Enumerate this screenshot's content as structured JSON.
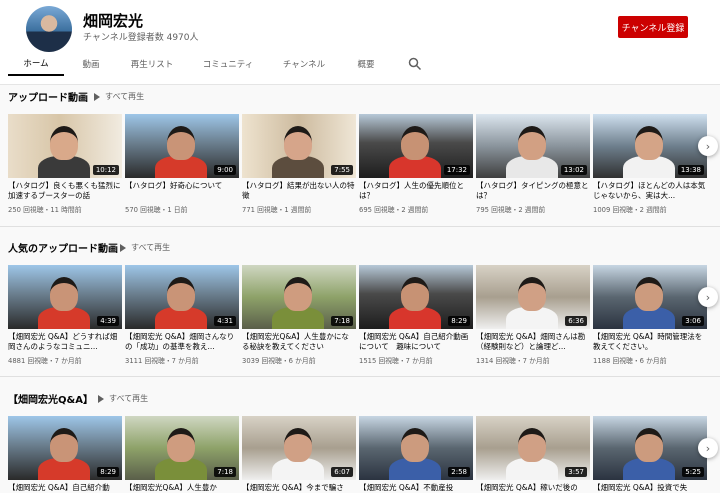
{
  "channel": {
    "name": "畑岡宏光",
    "subscribers": "チャンネル登録者数 4970人",
    "subscribe_label": "チャンネル登録"
  },
  "tabs": [
    "ホーム",
    "動画",
    "再生リスト",
    "コミュニティ",
    "チャンネル",
    "概要"
  ],
  "active_tab": "ホーム",
  "sections": [
    {
      "title": "アップロード動画",
      "play_all": "すべて再生",
      "videos": [
        {
          "title": "【ハタログ】良くも悪くも猛烈に加速するブースターの話",
          "meta": "250 回視聴・11 時間前",
          "duration": "10:12"
        },
        {
          "title": "【ハタログ】好奇心について",
          "meta": "570 回視聴・1 日前",
          "duration": "9:00"
        },
        {
          "title": "【ハタログ】結果が出ない人の特徴",
          "meta": "771 回視聴・1 週間前",
          "duration": "7:55"
        },
        {
          "title": "【ハタログ】人生の優先順位とは？",
          "meta": "695 回視聴・2 週間前",
          "duration": "17:32"
        },
        {
          "title": "【ハタログ】タイピングの極意とは？",
          "meta": "795 回視聴・2 週間前",
          "duration": "13:02"
        },
        {
          "title": "【ハタログ】ほとんどの人は本気じゃないから、実は大...",
          "meta": "1009 回視聴・2 週間前",
          "duration": "13:38"
        }
      ]
    },
    {
      "title": "人気のアップロード動画",
      "play_all": "すべて再生",
      "videos": [
        {
          "title": "【畑岡宏光 Q&A】どうすれば畑岡さんのようなコミュニ...",
          "meta": "4881 回視聴・7 か月前",
          "duration": "4:39"
        },
        {
          "title": "【畑岡宏光 Q&A】畑岡さんなりの「成功」の基準を教え...",
          "meta": "3111 回視聴・7 か月前",
          "duration": "4:31"
        },
        {
          "title": "【畑岡宏光Q&A】人生豊かになる秘訣を教えてください",
          "meta": "3039 回視聴・6 か月前",
          "duration": "7:18"
        },
        {
          "title": "【畑岡宏光 Q&A】自己紹介動画について　趣味について",
          "meta": "1515 回視聴・7 か月前",
          "duration": "8:29"
        },
        {
          "title": "【畑岡宏光 Q&A】畑岡さんは勘（経験則など）と論理ど...",
          "meta": "1314 回視聴・7 か月前",
          "duration": "6:36"
        },
        {
          "title": "【畑岡宏光 Q&A】時間管理法を教えてください。",
          "meta": "1188 回視聴・6 か月前",
          "duration": "3:06"
        }
      ]
    },
    {
      "title": "【畑岡宏光Q&A】",
      "play_all": "すべて再生",
      "videos": [
        {
          "title": "【畑岡宏光 Q&A】自己紹介動",
          "meta": "",
          "duration": "8:29"
        },
        {
          "title": "【畑岡宏光Q&A】人生豊か",
          "meta": "",
          "duration": "7:18"
        },
        {
          "title": "【畑岡宏光 Q&A】今まで騙さ",
          "meta": "",
          "duration": "6:07"
        },
        {
          "title": "【畑岡宏光 Q&A】不動産投",
          "meta": "",
          "duration": "2:58"
        },
        {
          "title": "【畑岡宏光 Q&A】稼いだ後の",
          "meta": "",
          "duration": "3:57"
        },
        {
          "title": "【畑岡宏光 Q&A】投資で失",
          "meta": "",
          "duration": "5:25"
        }
      ]
    }
  ],
  "colors": {
    "subscribe": "#cc0000",
    "text": "#030303",
    "secondary": "#606060",
    "page_bg": "#f9f9f9"
  }
}
